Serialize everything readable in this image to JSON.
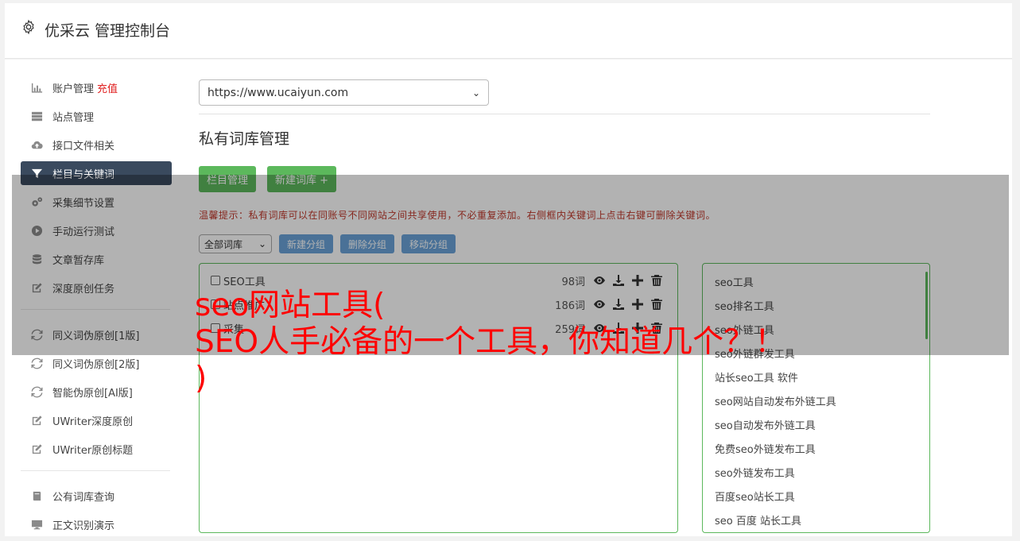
{
  "app": {
    "title": "优采云 管理控制台"
  },
  "sidebar": {
    "group1": [
      {
        "label": "账户管理",
        "badge": "充值",
        "icon": "bar-chart-icon"
      },
      {
        "label": "站点管理",
        "icon": "server-icon"
      },
      {
        "label": "接口文件相关",
        "icon": "cloud-upload-icon"
      },
      {
        "label": "栏目与关键词",
        "icon": "filter-icon",
        "active": true
      },
      {
        "label": "采集细节设置",
        "icon": "gears-icon"
      },
      {
        "label": "手动运行测试",
        "icon": "play-circle-icon"
      },
      {
        "label": "文章暂存库",
        "icon": "database-icon"
      },
      {
        "label": "深度原创任务",
        "icon": "edit-icon"
      }
    ],
    "group2": [
      {
        "label": "同义词伪原创[1版]",
        "icon": "refresh-icon"
      },
      {
        "label": "同义词伪原创[2版]",
        "icon": "refresh-icon"
      },
      {
        "label": "智能伪原创[AI版]",
        "icon": "refresh-icon"
      },
      {
        "label": "UWriter深度原创",
        "icon": "edit-icon"
      },
      {
        "label": "UWriter原创标题",
        "icon": "edit-icon"
      }
    ],
    "group3": [
      {
        "label": "公有词库查询",
        "icon": "book-icon"
      },
      {
        "label": "正文识别演示",
        "icon": "monitor-icon"
      }
    ]
  },
  "main": {
    "site_select": "https://www.ucaiyun.com",
    "section_title": "私有词库管理",
    "btn_columns": "栏目管理",
    "btn_new_lib": "新建词库 +",
    "tip": "温馨提示：私有词库可以在同账号不同网站之间共享使用，不必重复添加。右侧框内关键词上点击右键可删除关键词。",
    "filter_select": "全部词库",
    "btn_new_group": "新建分组",
    "btn_del_group": "删除分组",
    "btn_move_group": "移动分组"
  },
  "libraries": [
    {
      "name": "SEO工具",
      "count": "98词"
    },
    {
      "name": "站点推广",
      "count": "186词"
    },
    {
      "name": "采集",
      "count": "259词"
    }
  ],
  "keywords": [
    "seo工具",
    "seo排名工具",
    "seo外链工具",
    "seo外链群发工具",
    "站长seo工具 软件",
    "seo网站自动发布外链工具",
    "seo自动发布外链工具",
    "免费seo外链发布工具",
    "seo外链发布工具",
    "百度seo站长工具",
    "seo 百度 站长工具"
  ],
  "overlay": {
    "headline_1": "seo网站工具(",
    "headline_2": "SEO人手必备的一个工具，你知道几个？！",
    "headline_3": ")"
  }
}
